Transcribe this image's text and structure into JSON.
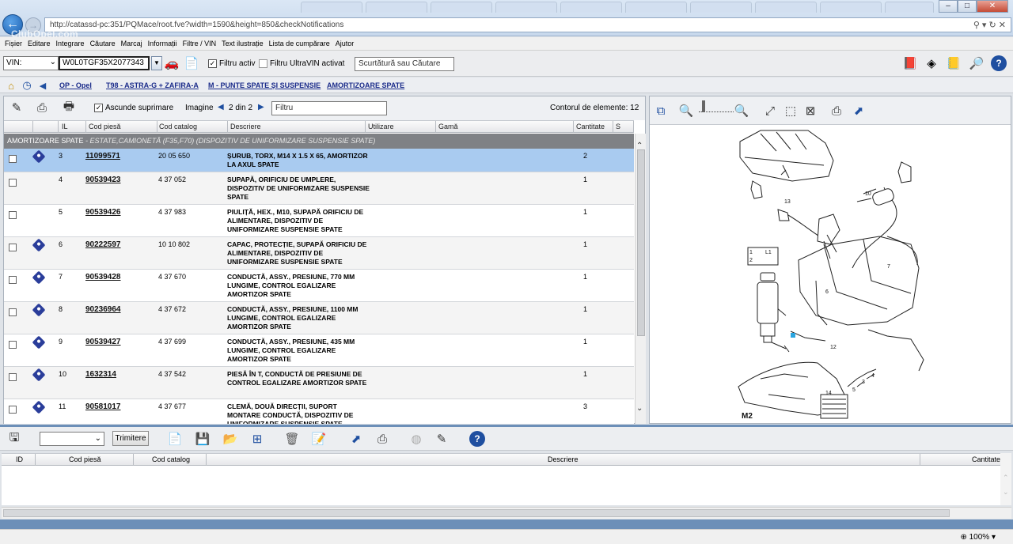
{
  "browser": {
    "url": "http://catassd-pc:351/PQMace/root.fve?width=1590&height=850&checkNotifications",
    "back_glyph": "←",
    "forward_glyph": "→",
    "address_icons": "⚲ ▾ ↻ ✕",
    "watermark": "ClubOpel.com",
    "win_minimize": "–",
    "win_maximize": "□",
    "win_close": "✕"
  },
  "menu": [
    "Fișier",
    "Editare",
    "Integrare",
    "Căutare",
    "Marcaj",
    "Informații",
    "Filtre / VIN",
    "Text ilustrație",
    "Lista de cumpărare",
    "Ajutor"
  ],
  "toolbar": {
    "vin_select": "VIN:",
    "vin_value": "W0L0TGF35X2077343",
    "filter_active_label": "Filtru activ",
    "filter_active_checked": true,
    "ultravin_label": "Filtru UltraVIN activat",
    "ultravin_checked": false,
    "shortcut_placeholder": "Scurtătură sau Căutare"
  },
  "breadcrumb": [
    "OP - Opel",
    "T98 - ASTRA-G + ZAFIRA-A",
    "M - PUNTE SPATE ȘI SUSPENSIE",
    "AMORTIZOARE SPATE"
  ],
  "list_toolbar": {
    "hide_deleted_label": "Ascunde suprimare",
    "hide_deleted_checked": true,
    "image_label": "Imagine",
    "image_page": "2 din 2",
    "filter_placeholder": "Filtru",
    "element_count": "Contorul de elemente: 12"
  },
  "columns": [
    "IL",
    "Cod piesă",
    "Cod catalog",
    "Descriere",
    "Utilizare",
    "Gamă",
    "Cantitate",
    "S"
  ],
  "group": {
    "title": "AMORTIZOARE SPATE",
    "subtitle": " - ESTATE,CAMIONETĂ (F35,F70) (DISPOZITIV DE UNIFORMIZARE SUSPENSIE SPATE)"
  },
  "rows": [
    {
      "il": "3",
      "part": "11099571",
      "catalog": "20 05 650",
      "desc": "ȘURUB, TORX, M14 X 1.5 X 65, AMORTIZOR LA AXUL SPATE",
      "qty": "2",
      "camera": true,
      "selected": true
    },
    {
      "il": "4",
      "part": "90539423",
      "catalog": "4 37 052",
      "desc": "SUPAPĂ, ORIFICIU DE UMPLERE, DISPOZITIV DE UNIFORMIZARE SUSPENSIE SPATE",
      "qty": "1",
      "camera": false
    },
    {
      "il": "5",
      "part": "90539426",
      "catalog": "4 37 983",
      "desc": "PIULIȚĂ, HEX., M10, SUPAPĂ ORIFICIU DE ALIMENTARE, DISPOZITIV DE UNIFORMIZARE SUSPENSIE SPATE",
      "qty": "1",
      "camera": false
    },
    {
      "il": "6",
      "part": "90222597",
      "catalog": "10 10 802",
      "desc": "CAPAC, PROTECȚIE, SUPAPĂ ORIFICIU DE ALIMENTARE, DISPOZITIV DE UNIFORMIZARE SUSPENSIE SPATE",
      "qty": "1",
      "camera": true
    },
    {
      "il": "7",
      "part": "90539428",
      "catalog": "4 37 670",
      "desc": "CONDUCTĂ, ASSY., PRESIUNE, 770 MM LUNGIME, CONTROL EGALIZARE AMORTIZOR SPATE",
      "qty": "1",
      "camera": true
    },
    {
      "il": "8",
      "part": "90236964",
      "catalog": "4 37 672",
      "desc": "CONDUCTĂ, ASSY., PRESIUNE, 1100 MM LUNGIME, CONTROL EGALIZARE AMORTIZOR SPATE",
      "qty": "1",
      "camera": true
    },
    {
      "il": "9",
      "part": "90539427",
      "catalog": "4 37 699",
      "desc": "CONDUCTĂ, ASSY., PRESIUNE, 435 MM LUNGIME, CONTROL EGALIZARE AMORTIZOR SPATE",
      "qty": "1",
      "camera": true
    },
    {
      "il": "10",
      "part": "1632314",
      "catalog": "4 37 542",
      "desc": "PIESĂ ÎN T, CONDUCTĂ DE PRESIUNE DE CONTROL EGALIZARE AMORTIZOR SPATE",
      "qty": "1",
      "camera": true
    },
    {
      "il": "11",
      "part": "90581017",
      "catalog": "4 37 677",
      "desc": "CLEMĂ, DOUĂ DIRECȚII, SUPORT MONTARE CONDUCTĂ, DISPOZITIV DE UNIFORMIZARE SUSPENSIE SPATE",
      "qty": "3",
      "camera": true
    }
  ],
  "diagram": {
    "labels": {
      "n13": "13",
      "n10": "10",
      "n7": "7",
      "n6": "6",
      "n12": "12",
      "n14": "14",
      "n4": "4",
      "n5": "5",
      "n3": "3",
      "l1": "L1",
      "r1": "1",
      "r2": "2",
      "page": "M2"
    }
  },
  "cart": {
    "trim_button": "Trimitere",
    "columns": [
      "ID",
      "Cod piesă",
      "Cod catalog",
      "Descriere",
      "Cantitate"
    ]
  },
  "status": {
    "zoom": "100%"
  },
  "icons": {
    "edit": "✎",
    "print": "⎙",
    "print_preview": "🖶",
    "prev": "◀",
    "next": "▶",
    "home": "⌂",
    "history": "◷",
    "back": "◀",
    "save": "💾",
    "new": "📄",
    "open": "📂",
    "add": "⊞",
    "delete": "🗑",
    "note": "📝",
    "help": "?",
    "zoom_in": "🔍",
    "zoom_out": "🔍",
    "fit": "⤢",
    "car": "🚗",
    "doc": "📄"
  },
  "colors": {
    "selection": "#a9cbf0",
    "group_header": "#7f8185",
    "link": "#1a2b8a",
    "accent": "#6c8fb8"
  }
}
